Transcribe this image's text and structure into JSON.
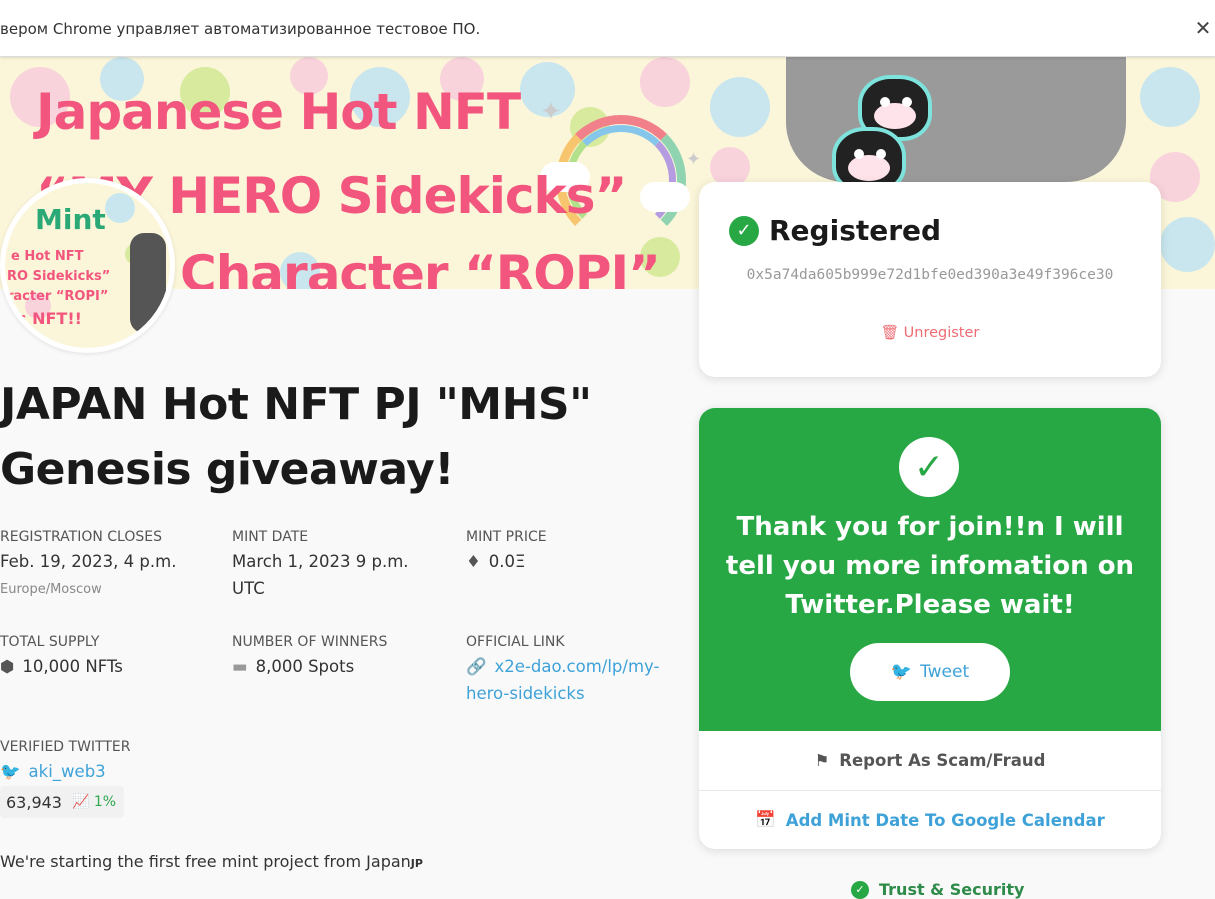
{
  "infobar": {
    "text": "вером Chrome управляет автоматизированное тестовое ПО.",
    "close_glyph": "✕"
  },
  "banner": {
    "line1": "Japanese Hot NFT",
    "line2": "“MY HERO Sidekicks”",
    "line3": "Character “ROPI”"
  },
  "avatar": {
    "line1": "Mint",
    "line2": "e Hot NFT",
    "line3": "RO Sidekicks”",
    "line4": "racter “ROPI”",
    "line5": "s NFT!!"
  },
  "project": {
    "title_line1": "JAPAN Hot NFT PJ \"MHS\"",
    "title_line2": "Genesis giveaway!"
  },
  "details": {
    "registration_closes_label": "REGISTRATION CLOSES",
    "registration_closes_value": "Feb. 19, 2023, 4 p.m.",
    "registration_closes_tz": "Europe/Moscow",
    "mint_date_label": "MINT DATE",
    "mint_date_line1": "March 1, 2023 9 p.m.",
    "mint_date_line2": "UTC",
    "mint_price_label": "MINT PRICE",
    "mint_price_value": "0.0Ξ",
    "total_supply_label": "TOTAL SUPPLY",
    "total_supply_value": "10,000 NFTs",
    "winners_label": "NUMBER OF WINNERS",
    "winners_value": "8,000 Spots",
    "official_link_label": "OFFICIAL LINK",
    "official_link_line1": "x2e-dao.com/lp/my-",
    "official_link_line2": "hero-sidekicks",
    "verified_twitter_label": "VERIFIED TWITTER",
    "twitter_handle": "aki_web3",
    "followers": "63,943",
    "growth": "1%"
  },
  "description": {
    "text": "We're starting the first free mint project from Japan",
    "suffix": "JP"
  },
  "registration": {
    "status": "Registered",
    "address": "0x5a74da605b999e72d1bfe0ed390a3e49f396ce30",
    "unregister_label": "Unregister"
  },
  "thanks": {
    "message": "Thank you for join!!n I will tell you more infomation on Twitter.Please wait!",
    "tweet_label": "Tweet",
    "report_label": "Report As Scam/Fraud",
    "calendar_label": "Add Mint Date To Google Calendar"
  },
  "trust": {
    "label": "Trust & Security"
  },
  "colors": {
    "accent_green": "#28a745",
    "link_blue": "#3ea2d8",
    "banner_pink": "#f2557d",
    "unregister_red": "#ee6b73"
  }
}
